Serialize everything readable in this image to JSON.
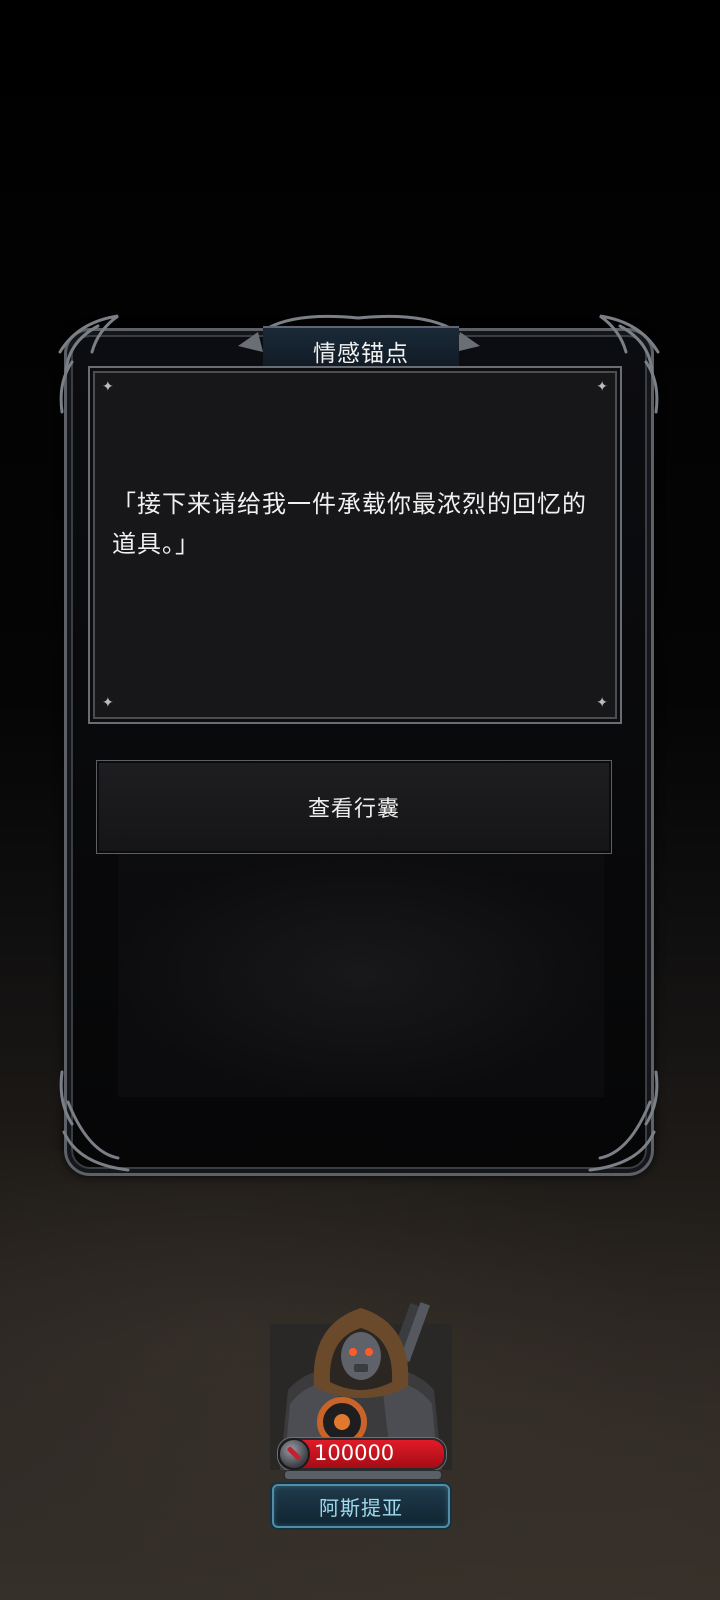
{
  "dialog": {
    "title": "情感锚点",
    "message": "「接下来请给我一件承载你最浓烈的回忆的道具。」",
    "button_label": "查看行囊"
  },
  "character": {
    "hp_value": "100000",
    "name": "阿斯提亚",
    "hp_icon": "sword-icon",
    "accent_color": "#e01c28"
  }
}
